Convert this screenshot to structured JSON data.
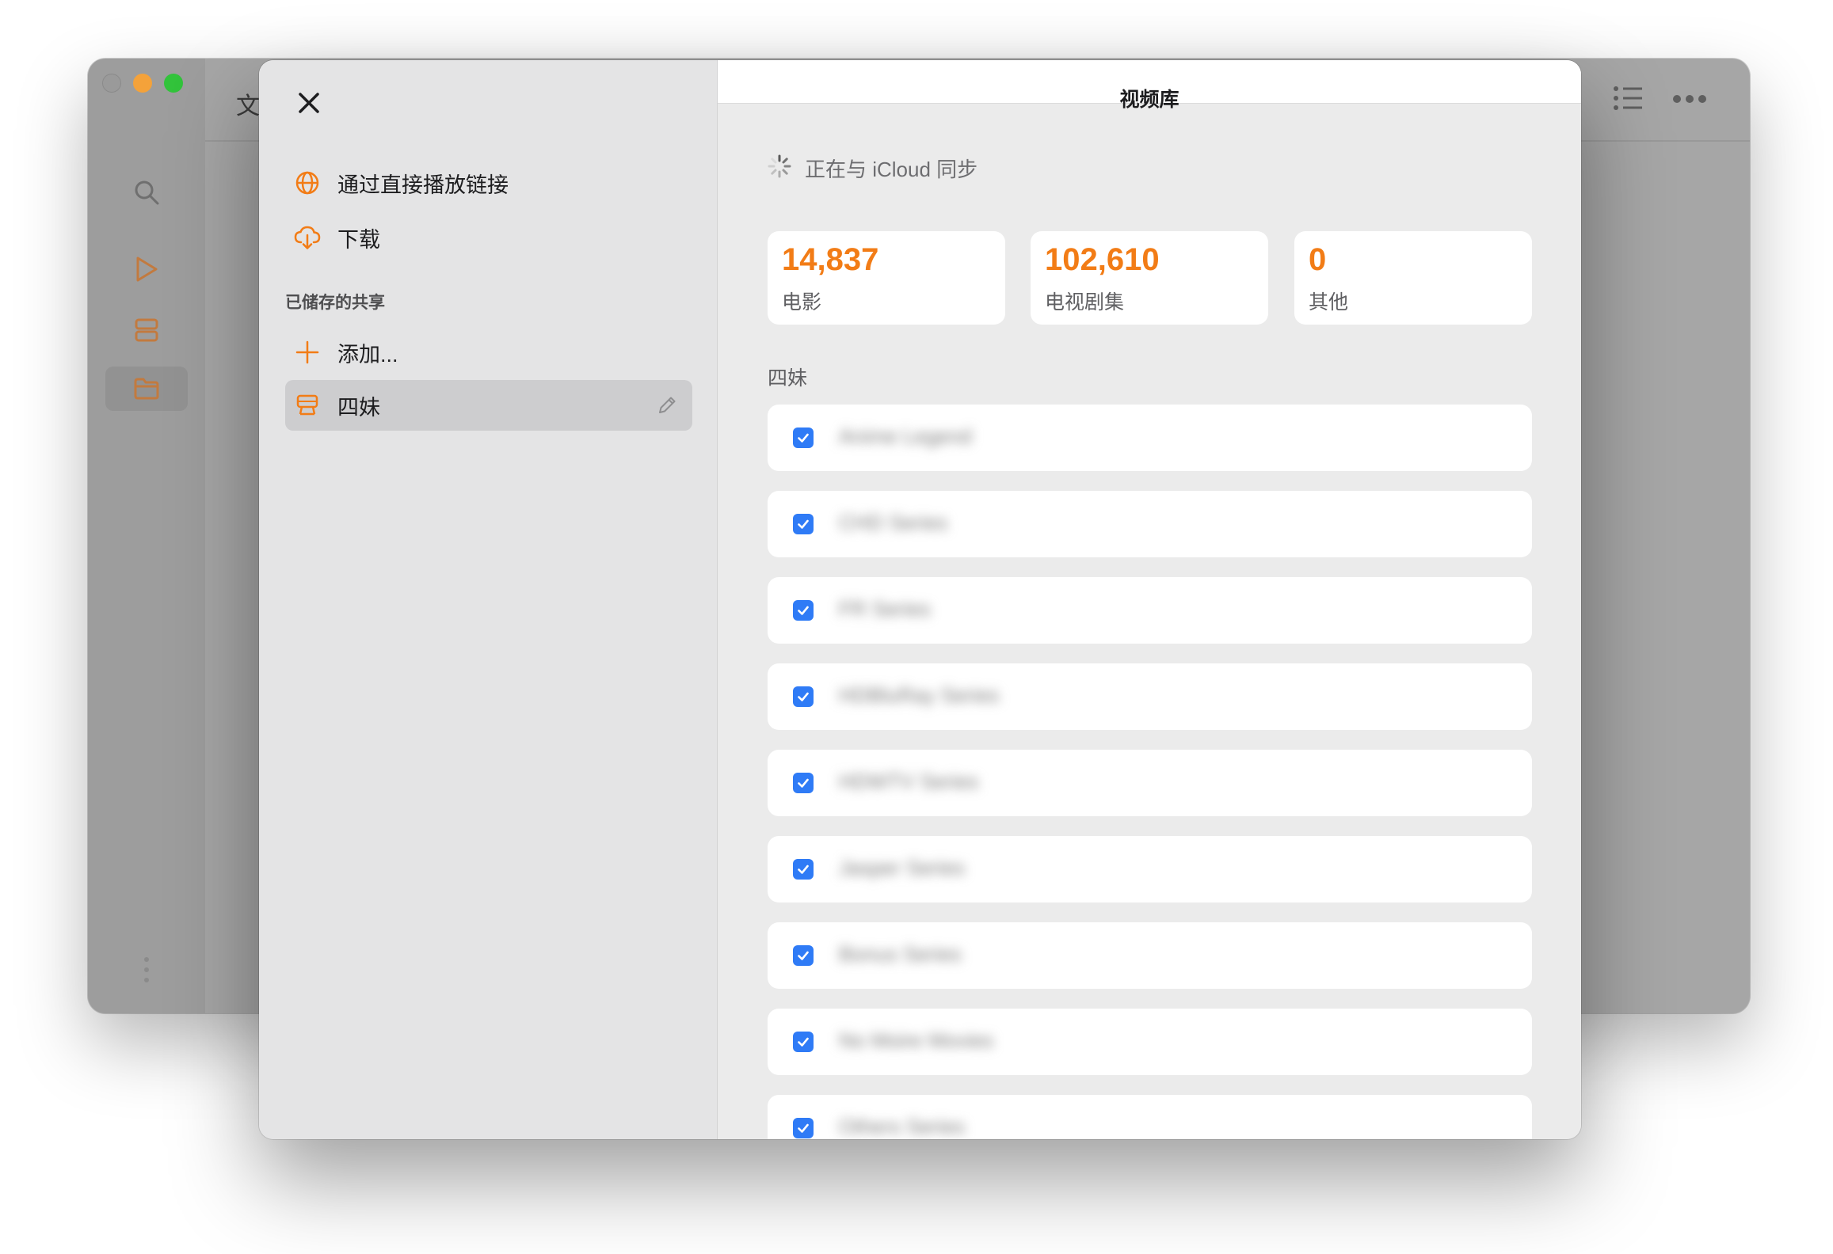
{
  "background_window": {
    "title_partial": "文"
  },
  "modal": {
    "title": "视频库",
    "nav": [
      {
        "label": "通过直接播放链接",
        "icon": "globe-icon"
      },
      {
        "label": "下载",
        "icon": "cloud-download-icon"
      }
    ],
    "saved_shares_header": "已储存的共享",
    "add_label": "添加...",
    "share_item": {
      "label": "四妹",
      "icon": "server-drive-icon",
      "selected": true
    },
    "sync_status": "正在与 iCloud 同步",
    "stats": [
      {
        "value": "14,837",
        "label": "电影"
      },
      {
        "value": "102,610",
        "label": "电视剧集"
      },
      {
        "value": "0",
        "label": "其他"
      }
    ],
    "group_label": "四妹",
    "folders": [
      {
        "name": "Anime Legend",
        "checked": true
      },
      {
        "name": "CHD Series",
        "checked": true
      },
      {
        "name": "FR Series",
        "checked": true
      },
      {
        "name": "HDBluRay Series",
        "checked": true
      },
      {
        "name": "HDWTV Series",
        "checked": true
      },
      {
        "name": "Jasper Series",
        "checked": true
      },
      {
        "name": "Bonus Series",
        "checked": true
      },
      {
        "name": "No Moire Movies",
        "checked": true
      },
      {
        "name": "Others Series",
        "checked": true
      }
    ]
  },
  "colors": {
    "accent": "#f27c16",
    "checkbox": "#2f7bf6",
    "selected_row": "#cdcdcf"
  }
}
